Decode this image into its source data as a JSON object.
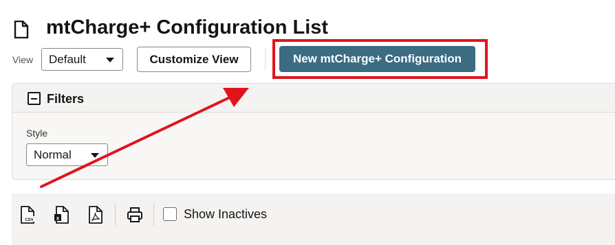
{
  "header": {
    "title": "mtCharge+ Configuration List",
    "page_icon": "document-icon"
  },
  "view_bar": {
    "view_label": "View",
    "view_value": "Default",
    "customize_label": "Customize View",
    "new_label": "New mtCharge+ Configuration"
  },
  "filters": {
    "title": "Filters",
    "style_label": "Style",
    "style_value": "Normal"
  },
  "toolbar": {
    "icons": [
      "csv-export-icon",
      "excel-export-icon",
      "pdf-export-icon",
      "print-icon"
    ],
    "show_inactives_label": "Show Inactives",
    "show_inactives_checked": false
  },
  "annotation": {
    "highlight_color": "#e0141c"
  },
  "colors": {
    "primary_button": "#3b6c82",
    "panel_bg": "#f8f7f5",
    "toolbar_bg": "#f4f3f1"
  }
}
